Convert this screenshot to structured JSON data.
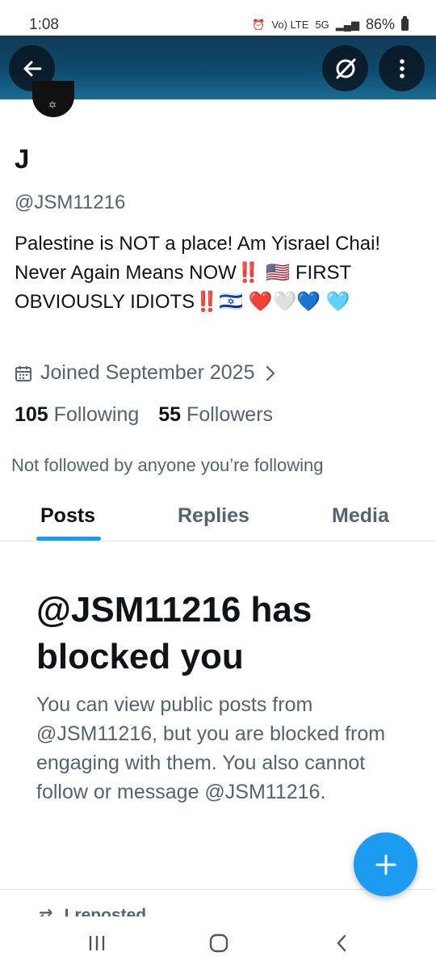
{
  "status_bar": {
    "time": "1:08",
    "network": "Vo) LTE",
    "network_5g": "5G",
    "battery": "86%"
  },
  "header": {
    "back_icon": "arrow-left-icon",
    "grok_icon": "grok-icon",
    "more_icon": "more-vertical-icon"
  },
  "profile": {
    "name": "J",
    "handle": "@JSM11216",
    "bio": "Palestine is NOT a place! Am Yisrael Chai! Never Again Means NOW‼️ 🇺🇸 FIRST OBVIOUSLY IDIOTS‼️🇮🇱 ❤️🤍💙 🩵",
    "joined": "Joined September 2025",
    "following_count": "105",
    "following_label": "Following",
    "followers_count": "55",
    "followers_label": "Followers",
    "not_followed_text": "Not followed by anyone you’re following"
  },
  "tabs": [
    {
      "label": "Posts",
      "active": true
    },
    {
      "label": "Replies",
      "active": false
    },
    {
      "label": "Media",
      "active": false
    }
  ],
  "blocked": {
    "title": "@JSM11216 has blocked you",
    "message": "You can view public posts from @JSM11216, but you are blocked from engaging with them. You also cannot follow or message @JSM11216."
  },
  "feed": {
    "repost_label": "Lreposted"
  },
  "colors": {
    "accent": "#1d9bf0",
    "text_primary": "#0f1419",
    "text_secondary": "#536471"
  }
}
